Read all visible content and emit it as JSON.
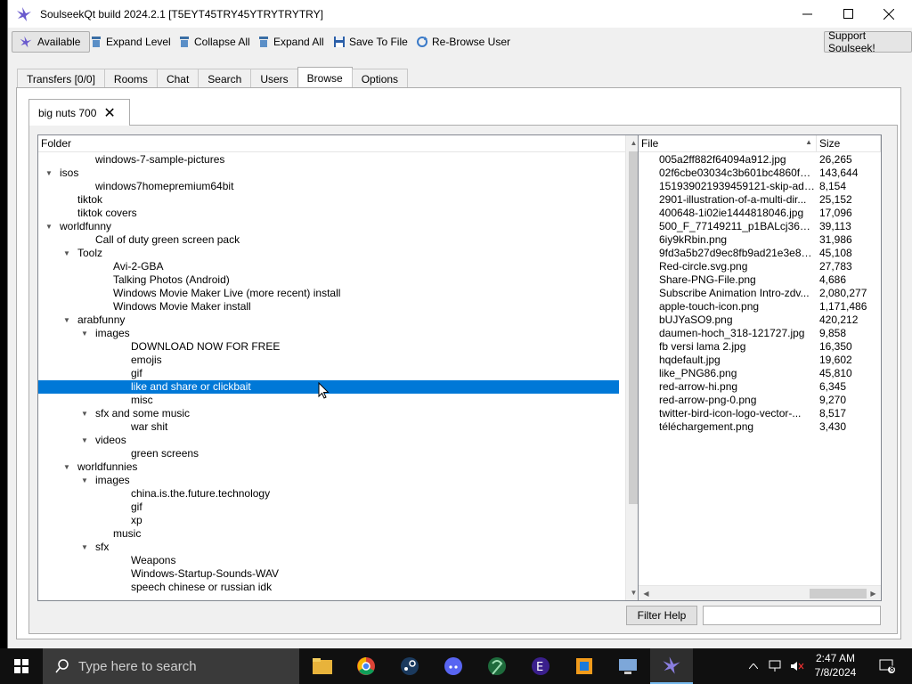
{
  "window": {
    "title": "SoulseekQt build 2024.2.1 [T5EYT45TRY45YTRYTRYTRY]",
    "controls": {
      "minimize": "—",
      "maximize": "☐",
      "close": "✕"
    }
  },
  "toolbar": {
    "available": "Available",
    "expand_level": "Expand Level",
    "collapse_all": "Collapse All",
    "expand_all": "Expand All",
    "save_to_file": "Save To File",
    "rebrowse_user": "Re-Browse User",
    "support": "Support Soulseek!"
  },
  "tabs": [
    {
      "label": "Transfers [0/0]",
      "active": false
    },
    {
      "label": "Rooms",
      "active": false
    },
    {
      "label": "Chat",
      "active": false
    },
    {
      "label": "Search",
      "active": false
    },
    {
      "label": "Users",
      "active": false
    },
    {
      "label": "Browse",
      "active": true
    },
    {
      "label": "Options",
      "active": false
    }
  ],
  "user_tab": {
    "label": "big nuts 700",
    "close": "✕"
  },
  "folder_view": {
    "header": "Folder",
    "selected": "like and share or clickbait",
    "rows": [
      {
        "label": "windows-7-sample-pictures",
        "level": 2,
        "expanded": null
      },
      {
        "label": "isos",
        "level": 0,
        "expanded": true
      },
      {
        "label": "windows7homepremium64bit",
        "level": 2,
        "expanded": null
      },
      {
        "label": "tiktok",
        "level": 1,
        "expanded": null
      },
      {
        "label": "tiktok covers",
        "level": 1,
        "expanded": null
      },
      {
        "label": "worldfunny",
        "level": 0,
        "expanded": true
      },
      {
        "label": "Call of duty green screen pack",
        "level": 2,
        "expanded": null
      },
      {
        "label": "Toolz",
        "level": 1,
        "expanded": true
      },
      {
        "label": "Avi-2-GBA",
        "level": 3,
        "expanded": null
      },
      {
        "label": "Talking Photos (Android)",
        "level": 3,
        "expanded": null
      },
      {
        "label": "Windows Movie Maker Live (more recent) install",
        "level": 3,
        "expanded": null
      },
      {
        "label": "Windows Movie Maker install",
        "level": 3,
        "expanded": null
      },
      {
        "label": "arabfunny",
        "level": 1,
        "expanded": true
      },
      {
        "label": "images",
        "level": 2,
        "expanded": true
      },
      {
        "label": "DOWNLOAD NOW FOR FREE",
        "level": 4,
        "expanded": null
      },
      {
        "label": "emojis",
        "level": 4,
        "expanded": null
      },
      {
        "label": "gif",
        "level": 4,
        "expanded": null
      },
      {
        "label": "like and share or clickbait",
        "level": 4,
        "expanded": null
      },
      {
        "label": "misc",
        "level": 4,
        "expanded": null
      },
      {
        "label": "sfx and some music",
        "level": 2,
        "expanded": true
      },
      {
        "label": "war shit",
        "level": 4,
        "expanded": null
      },
      {
        "label": "videos",
        "level": 2,
        "expanded": true
      },
      {
        "label": "green screens",
        "level": 4,
        "expanded": null
      },
      {
        "label": "worldfunnies",
        "level": 1,
        "expanded": true
      },
      {
        "label": "images",
        "level": 2,
        "expanded": true
      },
      {
        "label": "china.is.the.future.technology",
        "level": 4,
        "expanded": null
      },
      {
        "label": "gif",
        "level": 4,
        "expanded": null
      },
      {
        "label": "xp",
        "level": 4,
        "expanded": null
      },
      {
        "label": "music",
        "level": 3,
        "expanded": null
      },
      {
        "label": "sfx",
        "level": 2,
        "expanded": true
      },
      {
        "label": "Weapons",
        "level": 4,
        "expanded": null
      },
      {
        "label": "Windows-Startup-Sounds-WAV",
        "level": 4,
        "expanded": null
      },
      {
        "label": "speech chinese or russian idk",
        "level": 4,
        "expanded": null
      }
    ]
  },
  "file_view": {
    "header_file": "File",
    "header_size": "Size",
    "rows": [
      {
        "name": "005a2ff882f64094a912.jpg",
        "size": "26,265"
      },
      {
        "name": "02f6cbe03034c3b601bc4860fd9...",
        "size": "143,644"
      },
      {
        "name": "151939021939459121-skip-ad-s...",
        "size": "8,154"
      },
      {
        "name": "2901-illustration-of-a-multi-dir...",
        "size": "25,152"
      },
      {
        "name": "400648-1i02ie1444818046.jpg",
        "size": "17,096"
      },
      {
        "name": "500_F_77149211_p1BALcj36VgN...",
        "size": "39,113"
      },
      {
        "name": "6iy9kRbin.png",
        "size": "31,986"
      },
      {
        "name": "9fd3a5b27d9ec8fb9ad21e3e8df...",
        "size": "45,108"
      },
      {
        "name": "Red-circle.svg.png",
        "size": "27,783"
      },
      {
        "name": "Share-PNG-File.png",
        "size": "4,686"
      },
      {
        "name": "Subscribe Animation Intro-zdv...",
        "size": "2,080,277"
      },
      {
        "name": "apple-touch-icon.png",
        "size": "1,171,486"
      },
      {
        "name": "bUJYaSO9.png",
        "size": "420,212"
      },
      {
        "name": "daumen-hoch_318-121727.jpg",
        "size": "9,858"
      },
      {
        "name": "fb versi lama 2.jpg",
        "size": "16,350"
      },
      {
        "name": "hqdefault.jpg",
        "size": "19,602"
      },
      {
        "name": "like_PNG86.png",
        "size": "45,810"
      },
      {
        "name": "red-arrow-hi.png",
        "size": "6,345"
      },
      {
        "name": "red-arrow-png-0.png",
        "size": "9,270"
      },
      {
        "name": "twitter-bird-icon-logo-vector-...",
        "size": "8,517"
      },
      {
        "name": "téléchargement.png",
        "size": "3,430"
      }
    ]
  },
  "filter": {
    "button": "Filter Help",
    "value": ""
  },
  "taskbar": {
    "search_placeholder": "Type here to search",
    "time": "2:47 AM",
    "date": "7/8/2024",
    "notification_count": "8"
  }
}
